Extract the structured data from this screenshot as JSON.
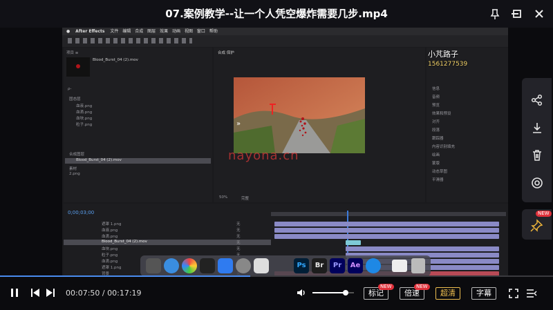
{
  "player": {
    "title": "07.案例教学--让一个人凭空爆炸需要几步.mp4",
    "window_controls": [
      "pin-icon",
      "minimize-icon",
      "maximize-icon",
      "close-icon"
    ],
    "time_current": "00:07:50",
    "time_separator": "/",
    "time_total": "00:17:19",
    "progress": 0.452,
    "volume": 0.8,
    "buttons": {
      "mark": "标记",
      "speed": "倍速",
      "quality": "超清",
      "subtitle": "字幕",
      "new_badge": "NEW"
    },
    "side_panel": [
      "share-icon",
      "download-icon",
      "delete-icon",
      "record-icon",
      "pin-new-icon"
    ],
    "side_new_badge": "NEW",
    "accent": "#4a8cf0",
    "quality_color": "#f0c050"
  },
  "video": {
    "menubar": {
      "app": "After Effects",
      "items": [
        "文件",
        "编辑",
        "合成",
        "图层",
        "效果",
        "动画",
        "视图",
        "窗口",
        "帮助"
      ]
    },
    "watermark_name": "小芃路子",
    "watermark_phone": "1561277539",
    "watermark_center": "nayona.cn",
    "project_panel": {
      "header": "项目 ≡",
      "file": "Blood_Burst_04 (2).mov",
      "search_placeholder": "ρ-",
      "items": [
        "固态层",
        "血液.png",
        "血滴.png",
        "血块.png",
        "粒子.png",
        "Blood_Burst_04 (2).mov",
        "合成图层",
        "素材",
        "2.png"
      ]
    },
    "comp_panel": {
      "tab": "合成 保护",
      "zoom": "50%",
      "quality": "完整"
    },
    "right_panel": {
      "items": [
        "信息",
        "音频",
        "预览",
        "效果和预设",
        "对齐",
        "段落",
        "跟踪器",
        "内容识别填充",
        "绘画",
        "蒙版",
        "动态草图",
        "平滑器"
      ]
    },
    "timeline": {
      "time": "0;00;03;00",
      "layers": [
        "遮罩 1.png",
        "血液.png",
        "血滴.png",
        "Blood_Burst_04 (2).mov",
        "血块.png",
        "粒子.png",
        "血滴.png",
        "遮罩 1.png",
        "背景"
      ],
      "modes": [
        "无",
        "无",
        "无",
        "无",
        "无",
        "无",
        "无",
        "无",
        "无"
      ]
    },
    "dock_apps": [
      "Ps",
      "Br",
      "Pr",
      "Ae"
    ]
  }
}
